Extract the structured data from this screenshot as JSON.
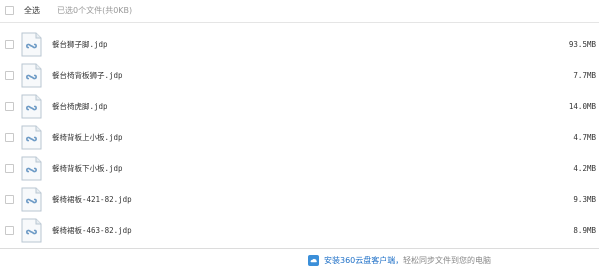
{
  "header": {
    "select_all_label": "全选",
    "selected_info": "已选0个文件(共0KB)"
  },
  "files": [
    {
      "name": "餐台狮子脚.jdp",
      "size": "93.5MB",
      "icon": "cloud-file-icon"
    },
    {
      "name": "餐台椅背板狮子.jdp",
      "size": "7.7MB",
      "icon": "cloud-file-icon"
    },
    {
      "name": "餐台椅虎脚.jdp",
      "size": "14.0MB",
      "icon": "cloud-file-icon"
    },
    {
      "name": "餐椅背板上小板.jdp",
      "size": "4.7MB",
      "icon": "cloud-file-icon"
    },
    {
      "name": "餐椅背板下小板.jdp",
      "size": "4.2MB",
      "icon": "cloud-file-icon"
    },
    {
      "name": "餐椅裙板-421-82.jdp",
      "size": "9.3MB",
      "icon": "cloud-file-icon"
    },
    {
      "name": "餐椅裙板-463-82.jdp",
      "size": "8.9MB",
      "icon": "cloud-file-icon"
    }
  ],
  "footer": {
    "promo_link": "安装360云盘客户端，",
    "promo_text": "轻松同步文件到您的电脑",
    "promo_icon": "cloud-drive-icon",
    "link_color": "#1d6fc7"
  }
}
